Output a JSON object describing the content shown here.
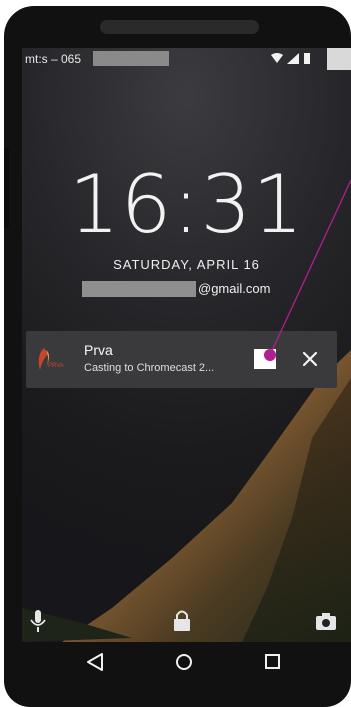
{
  "status_bar": {
    "carrier": "mt:s – 065",
    "icons": [
      "wifi-icon",
      "signal-icon",
      "battery-icon"
    ]
  },
  "lockscreen": {
    "time": "16:31",
    "date": "SATURDAY, APRIL 16",
    "email_suffix": "@gmail.com"
  },
  "notification": {
    "app_icon": "prva-app-icon",
    "app_icon_text": "PRVA",
    "title": "Prva",
    "text": "Casting to Chromecast 2...",
    "action_icon": "stop-cast-icon",
    "dismiss_icon": "close-icon"
  },
  "bottom_shortcuts": [
    "microphone-icon",
    "lock-icon",
    "camera-icon"
  ],
  "nav_bar": [
    "back-icon",
    "home-icon",
    "recents-icon"
  ],
  "colors": {
    "notification_bg": "#3a3a3c",
    "callout": "#b01f8f",
    "text": "#f2f2f2"
  }
}
